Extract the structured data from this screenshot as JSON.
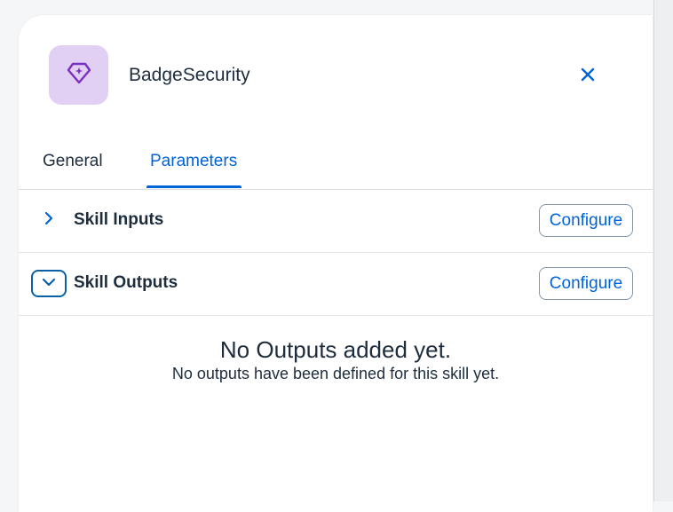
{
  "header": {
    "title": "BadgeSecurity",
    "icon": "diamond-sparkle-icon",
    "icon_bg_color": "#e1d0f3",
    "icon_color": "#7b2fbf"
  },
  "tabs": [
    {
      "label": "General",
      "selected": false
    },
    {
      "label": "Parameters",
      "selected": true
    }
  ],
  "sections": {
    "inputs": {
      "label": "Skill Inputs",
      "expanded": false,
      "configure_label": "Configure"
    },
    "outputs": {
      "label": "Skill Outputs",
      "expanded": true,
      "configure_label": "Configure"
    }
  },
  "empty_state": {
    "title": "No Outputs added yet.",
    "subtitle": "No outputs have been defined for this skill yet."
  },
  "colors": {
    "accent": "#0064d9",
    "text": "#1d2d3e"
  }
}
